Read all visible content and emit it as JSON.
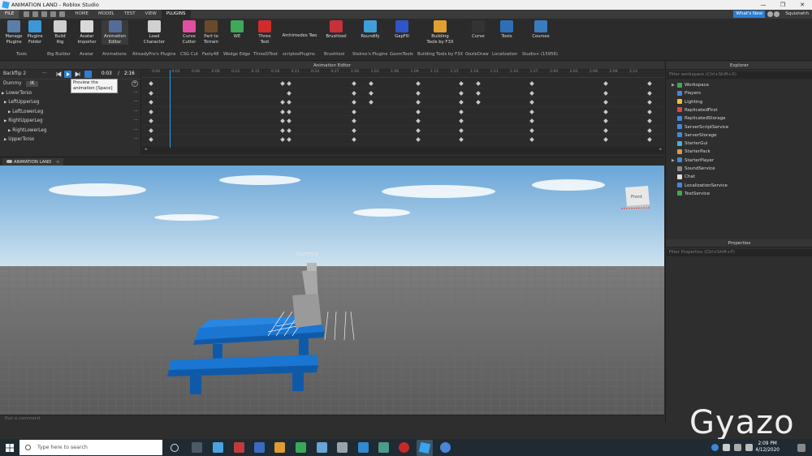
{
  "window": {
    "title": "ANIMATION LAND - Roblox Studio",
    "minimize": "—",
    "maximize": "❐",
    "close": "✕"
  },
  "menu": {
    "file": "FILE",
    "tabs": [
      "HOME",
      "MODEL",
      "TEST",
      "VIEW",
      "PLUGINS"
    ],
    "active_tab": "PLUGINS",
    "whats_new": "What's New",
    "user": "Squishehh"
  },
  "ribbon": {
    "tools": [
      {
        "label": "Manage\nPlugins",
        "color": "#5b7ea8"
      },
      {
        "label": "Plugins\nFolder",
        "color": "#3c97d9"
      },
      {
        "label": "Build\nRig",
        "color": "#cfcfcf"
      },
      {
        "label": "Avatar\nImporter",
        "color": "#d9d9d9"
      },
      {
        "label": "Animation\nEditor",
        "color": "#556b9a"
      },
      {
        "label": "Load\nCharacter",
        "color": "#d0d0d0"
      },
      {
        "label": "Curve\nCutter",
        "color": "#e04fa0"
      },
      {
        "label": "Part to\nTerrain",
        "color": "#6b4a2b"
      },
      {
        "label": "WE",
        "color": "#3fa85a"
      },
      {
        "label": "Three\nText",
        "color": "#d22b2b"
      },
      {
        "label": "Archimedes Two",
        "color": "#2b2b2b"
      },
      {
        "label": "Brushtool",
        "color": "#c8313a"
      },
      {
        "label": "Roundify",
        "color": "#3fa0d8"
      },
      {
        "label": "GapFill",
        "color": "#2f55c8"
      },
      {
        "label": "Building\nTools by F3X",
        "color": "#e0a030"
      },
      {
        "label": "Curve",
        "color": "#333333"
      },
      {
        "label": "Tools",
        "color": "#2f6fb8"
      },
      {
        "label": "Courses",
        "color": "#3a7cc0"
      }
    ],
    "groups": [
      "Tools",
      "Big Builder",
      "Avatar",
      "Animations",
      "AlreadyPro's Plugins",
      "CSG Cut",
      "Fasty48",
      "Wedge Edge",
      "ThreeDText",
      "scriptosPlugins",
      "Brushtool",
      "Stelrex's Plugins",
      "GeomTools",
      "Building Tools by F3X",
      "OozleDraw",
      "Localization",
      "Studio+ (15956)"
    ]
  },
  "anim_editor": {
    "header": "Animation Editor",
    "anim_name": "Backflip 2",
    "more": "···",
    "time_current": "0:03",
    "time_sep": "/",
    "time_total": "2:16",
    "rig": "Dummy",
    "ik": "IK",
    "add": "+",
    "rows": [
      "LowerTorso",
      "LeftUpperLeg",
      "LeftLowerLeg",
      "RightUpperLeg",
      "RightLowerLeg",
      "UpperTorso"
    ],
    "row_arrow": "▶",
    "ticks": [
      "0:00",
      "0:03",
      "0:06",
      "0:09",
      "0:12",
      "0:15",
      "0:18",
      "0:21",
      "0:24",
      "0:27",
      "1:00",
      "1:03",
      "1:06",
      "1:09",
      "1:12",
      "1:15",
      "1:18",
      "1:21",
      "1:24",
      "1:27",
      "2:00",
      "2:03",
      "2:06",
      "2:09",
      "2:12"
    ],
    "tooltip": "Preview the animation [Space]"
  },
  "viewport": {
    "tab": "ANIMATION LAND",
    "nametag": "Dummy",
    "view_cube": "Front"
  },
  "command_bar": {
    "placeholder": "Run a command"
  },
  "explorer": {
    "header": "Explorer",
    "filter": "Filter workspace (Ctrl+Shift+X)",
    "items": [
      {
        "label": "Workspace",
        "color": "#3fa85a",
        "arrow": "▶"
      },
      {
        "label": "Players",
        "color": "#4a86d6",
        "arrow": ""
      },
      {
        "label": "Lighting",
        "color": "#e8c33a",
        "arrow": ""
      },
      {
        "label": "ReplicatedFirst",
        "color": "#d64a4a",
        "arrow": ""
      },
      {
        "label": "ReplicatedStorage",
        "color": "#4a86d6",
        "arrow": ""
      },
      {
        "label": "ServerScriptService",
        "color": "#4a86d6",
        "arrow": ""
      },
      {
        "label": "ServerStorage",
        "color": "#4a86d6",
        "arrow": ""
      },
      {
        "label": "StarterGui",
        "color": "#4ab0d6",
        "arrow": ""
      },
      {
        "label": "StarterPack",
        "color": "#d69a4a",
        "arrow": ""
      },
      {
        "label": "StarterPlayer",
        "color": "#4a86d6",
        "arrow": "▶"
      },
      {
        "label": "SoundService",
        "color": "#8a8a8a",
        "arrow": ""
      },
      {
        "label": "Chat",
        "color": "#dcdcdc",
        "arrow": ""
      },
      {
        "label": "LocalizationService",
        "color": "#4a86d6",
        "arrow": ""
      },
      {
        "label": "TestService",
        "color": "#3fa85a",
        "arrow": ""
      }
    ]
  },
  "properties": {
    "header": "Properties",
    "filter": "Filter Properties (Ctrl+Shift+P)"
  },
  "taskbar": {
    "search": "Type here to search",
    "time": "2:09 PM",
    "date": "4/12/2020"
  },
  "watermark": "Gyazo"
}
